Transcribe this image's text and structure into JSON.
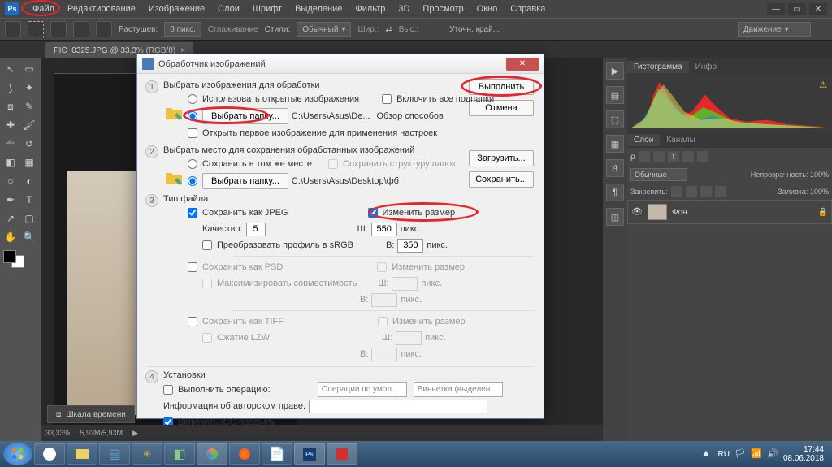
{
  "menubar": {
    "items": [
      "Файл",
      "Редактирование",
      "Изображение",
      "Слои",
      "Шрифт",
      "Выделение",
      "Фильтр",
      "3D",
      "Просмотр",
      "Окно",
      "Справка"
    ]
  },
  "optionsbar": {
    "feather_label": "Растушев:",
    "feather_value": "0 пикс.",
    "smoothing": "Сглаживание",
    "styles_label": "Стили:",
    "styles_value": "Обычный",
    "width_label": "Шир.:",
    "height_label": "Выс.:",
    "refine": "Уточн. край...",
    "move": "Движение"
  },
  "tab": {
    "title": "PIC_0325.JPG @ 33,3% (RGB/8)"
  },
  "dialog": {
    "title": "Обработчик изображений",
    "s1": {
      "title": "Выбрать изображения для обработки",
      "use_open": "Использовать открытые изображения",
      "include_sub": "Включить все подпапки",
      "select_btn": "Выбрать папку...",
      "path": "C:\\Users\\Asus\\De...",
      "browse": "Обзор способов",
      "open_first": "Открыть первое изображение для применения настроек"
    },
    "s2": {
      "title": "Выбрать место для сохранения обработанных изображений",
      "same": "Сохранить в том же месте",
      "keep_struct": "Сохранить структуру папок",
      "select_btn": "Выбрать папку...",
      "path": "C:\\Users\\Asus\\Desktop\\фб"
    },
    "s3": {
      "title": "Тип файла",
      "jpeg": "Сохранить как JPEG",
      "resize": "Изменить размер",
      "quality_label": "Качество:",
      "quality": "5",
      "w_label": "Ш:",
      "w": "550",
      "px": "пикс.",
      "h_label": "В:",
      "h": "350",
      "srgb": "Преобразовать профиль в sRGB",
      "psd": "Сохранить как PSD",
      "compat": "Максимизировать совместимость",
      "tiff": "Сохранить как TIFF",
      "lzw": "Сжатие LZW"
    },
    "s4": {
      "title": "Установки",
      "run_action": "Выполнить операцию:",
      "op_drop": "Операции по умол...",
      "vign_drop": "Виньетка (выделен...",
      "copyright": "Информация об авторском праве:",
      "icc": "Включить ICC-профиль"
    },
    "buttons": {
      "run": "Выполнить",
      "cancel": "Отмена",
      "load": "Загрузить...",
      "save": "Сохранить..."
    }
  },
  "panels": {
    "histogram": "Гистограмма",
    "info": "Инфо",
    "layers": "Слои",
    "channels": "Каналы",
    "blend": "Обычные",
    "opacity_label": "Непрозрачность:",
    "opacity": "100%",
    "lock_label": "Закрепить:",
    "fill_label": "Заливка:",
    "fill": "100%",
    "layer_name": "Фон"
  },
  "timeline": "Шкала времени",
  "status": {
    "zoom": "33,33%",
    "size": "5,93M/5,93M"
  },
  "tray": {
    "lang": "RU",
    "time": "17:44",
    "date": "08.06.2018"
  }
}
